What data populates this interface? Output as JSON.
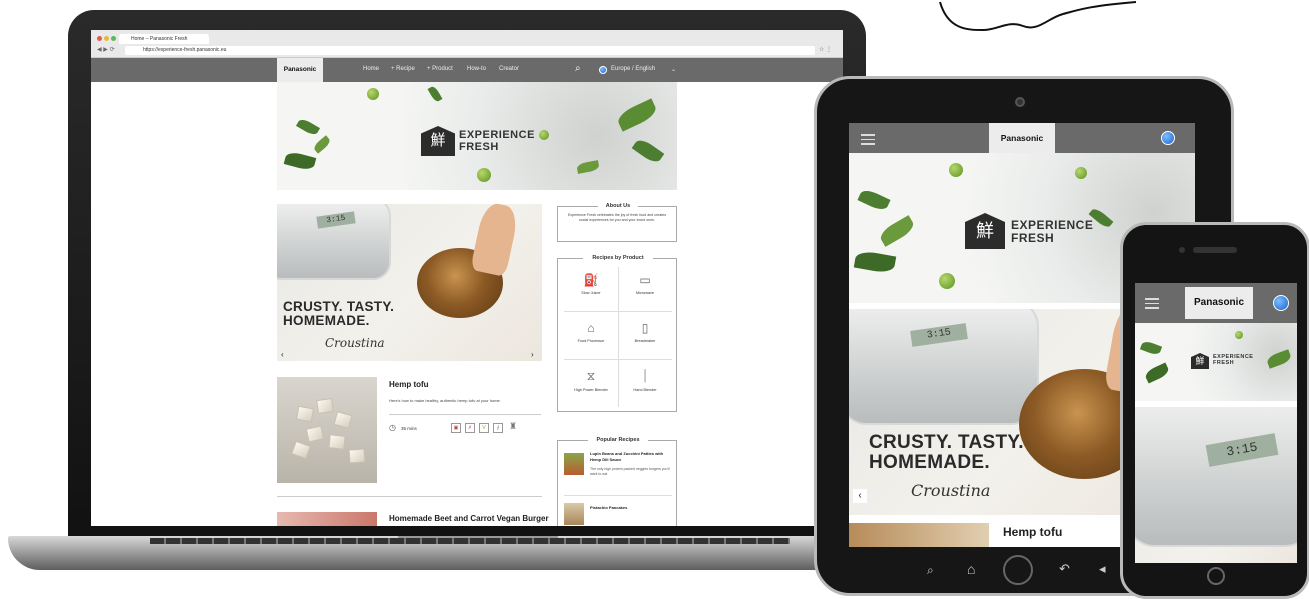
{
  "browser": {
    "tab_title": "Home – Panasonic Fresh",
    "url": "https://experience-fresh.panasonic.eu"
  },
  "site": {
    "logo": "Panasonic",
    "nav": [
      "Home",
      "+ Recipe",
      "+ Product",
      "How-to",
      "Creator"
    ],
    "language": "Europe / English",
    "brand_mark": "鮮",
    "brand_line1": "EXPERIENCE",
    "brand_line2": "FRESH"
  },
  "slider": {
    "headline1": "CRUSTY. TASTY.",
    "headline2": "HOMEMADE.",
    "script": "Croustina",
    "lcd": "3:15"
  },
  "recipes": [
    {
      "title": "Hemp tofu",
      "desc": "Here's how to make healthy, authentic hemp tofu at your home.",
      "time": "35 mins"
    },
    {
      "title": "Homemade Beet and Carrot Vegan Burger"
    }
  ],
  "about": {
    "title": "About Us",
    "text": "Experience Fresh celebrates the joy of fresh food and creates social experiences for you and your loved ones."
  },
  "products": {
    "title": "Recipes by Product",
    "items": [
      "Slow Juicer",
      "Microwave",
      "Food Processor",
      "Breadmaker",
      "High Power Blender",
      "Hand Blender"
    ]
  },
  "popular": {
    "title": "Popular Recipes",
    "items": [
      {
        "title": "Lupin Beans and Zucchini Patties with Hemp Dill Sauce",
        "desc": "The only high protein packed veggies burgers you'll want to eat."
      },
      {
        "title": "Pistachio Pancakes"
      }
    ]
  },
  "tablet": {
    "logo": "Panasonic",
    "headline1": "CRUSTY. TASTY.",
    "headline2": "HOMEMADE.",
    "script": "Croustina",
    "recipe_title": "Hemp tofu"
  },
  "phone": {
    "logo": "Panasonic",
    "lcd": "3:15"
  },
  "colors": {
    "nav_gray": "#6a6a6a",
    "accent_blue": "#1d5fd0",
    "leaf_green": "#4c7d30"
  }
}
